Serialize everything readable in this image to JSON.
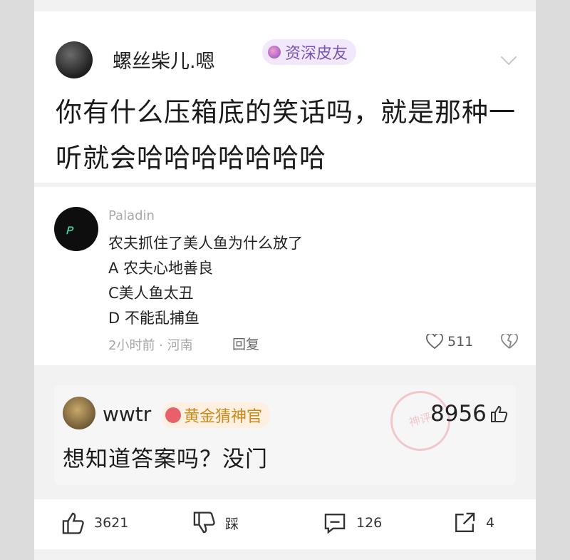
{
  "post": {
    "author": "螺丝柴儿.嗯",
    "badge": "资深皮友",
    "question": "你有什么压箱底的笑话吗，就是那种一听就会哈哈哈哈哈哈哈"
  },
  "comment": {
    "author": "Paladin",
    "avatar_text": "Ｐ",
    "lines": [
      "农夫抓住了美人鱼为什么放了",
      "A 农夫心地善良",
      "C美人鱼太丑",
      "D 不能乱捕鱼"
    ],
    "meta": "2小时前 · 河南",
    "reply_label": "回复",
    "likes": "511"
  },
  "answer": {
    "author": "wwtr",
    "badge": "黄金猜神官",
    "stamp": "神评",
    "likes": "8956",
    "text": "想知道答案吗？没门"
  },
  "actions": {
    "like_count": "3621",
    "dislike_label": "踩",
    "comment_count": "126",
    "share_count": "4"
  }
}
